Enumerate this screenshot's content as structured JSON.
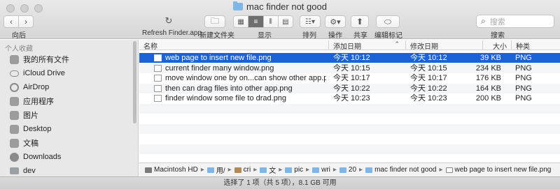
{
  "window": {
    "title": "mac finder not good"
  },
  "toolbar": {
    "back_label": "向后",
    "refresh_label": "Refresh Finder.app",
    "newfolder_label": "新建文件夹",
    "view_label": "显示",
    "arrange_label": "排列",
    "action_label": "操作",
    "share_label": "共享",
    "tags_label": "编辑标记",
    "search_label": "搜索",
    "search_placeholder": "搜索",
    "view_modes": [
      "icon-view",
      "list-view",
      "column-view",
      "gallery-view"
    ],
    "active_view": "list-view"
  },
  "sidebar": {
    "header": "个人收藏",
    "items": [
      {
        "label": "我的所有文件",
        "icon": "all-files-icon"
      },
      {
        "label": "iCloud Drive",
        "icon": "cloud-icon"
      },
      {
        "label": "AirDrop",
        "icon": "airdrop-icon"
      },
      {
        "label": "应用程序",
        "icon": "applications-icon"
      },
      {
        "label": "图片",
        "icon": "camera-icon"
      },
      {
        "label": "Desktop",
        "icon": "desktop-icon"
      },
      {
        "label": "文稿",
        "icon": "document-icon"
      },
      {
        "label": "Downloads",
        "icon": "download-icon"
      },
      {
        "label": "dev",
        "icon": "folder-icon"
      }
    ]
  },
  "columns": {
    "name": "名称",
    "added": "添加日期",
    "modified": "修改日期",
    "size": "大小",
    "kind": "种类"
  },
  "files": [
    {
      "name": "web page to insert new file.png",
      "added": "今天 10:12",
      "modified": "今天 10:12",
      "size": "39 KB",
      "kind": "PNG",
      "selected": true
    },
    {
      "name": "current finder many window.png",
      "added": "今天 10:15",
      "modified": "今天 10:15",
      "size": "234 KB",
      "kind": "PNG",
      "selected": false
    },
    {
      "name": "move window one by on...can show other app.png",
      "added": "今天 10:17",
      "modified": "今天 10:17",
      "size": "176 KB",
      "kind": "PNG",
      "selected": false
    },
    {
      "name": "then can drag files into other app.png",
      "added": "今天 10:22",
      "modified": "今天 10:22",
      "size": "164 KB",
      "kind": "PNG",
      "selected": false
    },
    {
      "name": "finder window some file to drad.png",
      "added": "今天 10:23",
      "modified": "今天 10:23",
      "size": "200 KB",
      "kind": "PNG",
      "selected": false
    }
  ],
  "pathbar": [
    "Macintosh HD",
    "用/",
    "cri",
    "文",
    "pic",
    "wri",
    "20",
    "mac finder not good",
    "web page to insert new file.png"
  ],
  "status": "选择了 1 项（共 5 项），8.1 GB 可用",
  "colors": {
    "selection": "#1b62d6",
    "folder": "#7fb6e6"
  }
}
